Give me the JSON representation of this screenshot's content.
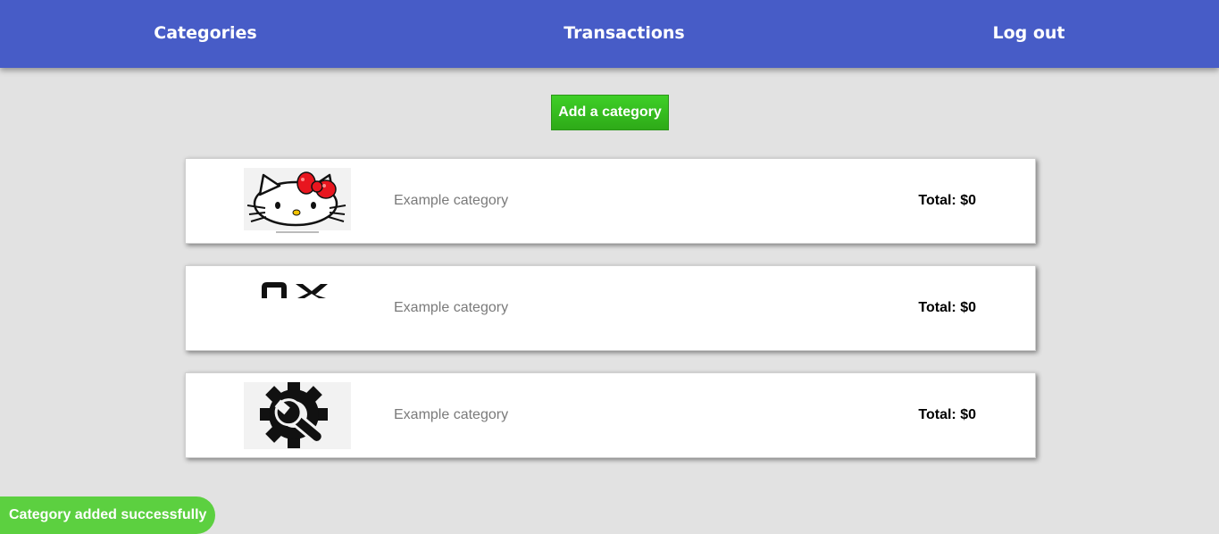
{
  "nav": {
    "categories": "Categories",
    "transactions": "Transactions",
    "logout": "Log out"
  },
  "add_category_button": "Add a category",
  "categories": [
    {
      "name": "Example category",
      "total": "Total: $0",
      "icon": "hello-kitty-icon"
    },
    {
      "name": "Example category",
      "total": "Total: $0",
      "icon": "broken-image-icon"
    },
    {
      "name": "Example category",
      "total": "Total: $0",
      "icon": "settings-wrench-icon"
    }
  ],
  "toast": "Category added successfully",
  "colors": {
    "navbar": "#475cc7",
    "background": "#e2e2e2",
    "button": "#34b91e",
    "toast": "#5cd040"
  }
}
